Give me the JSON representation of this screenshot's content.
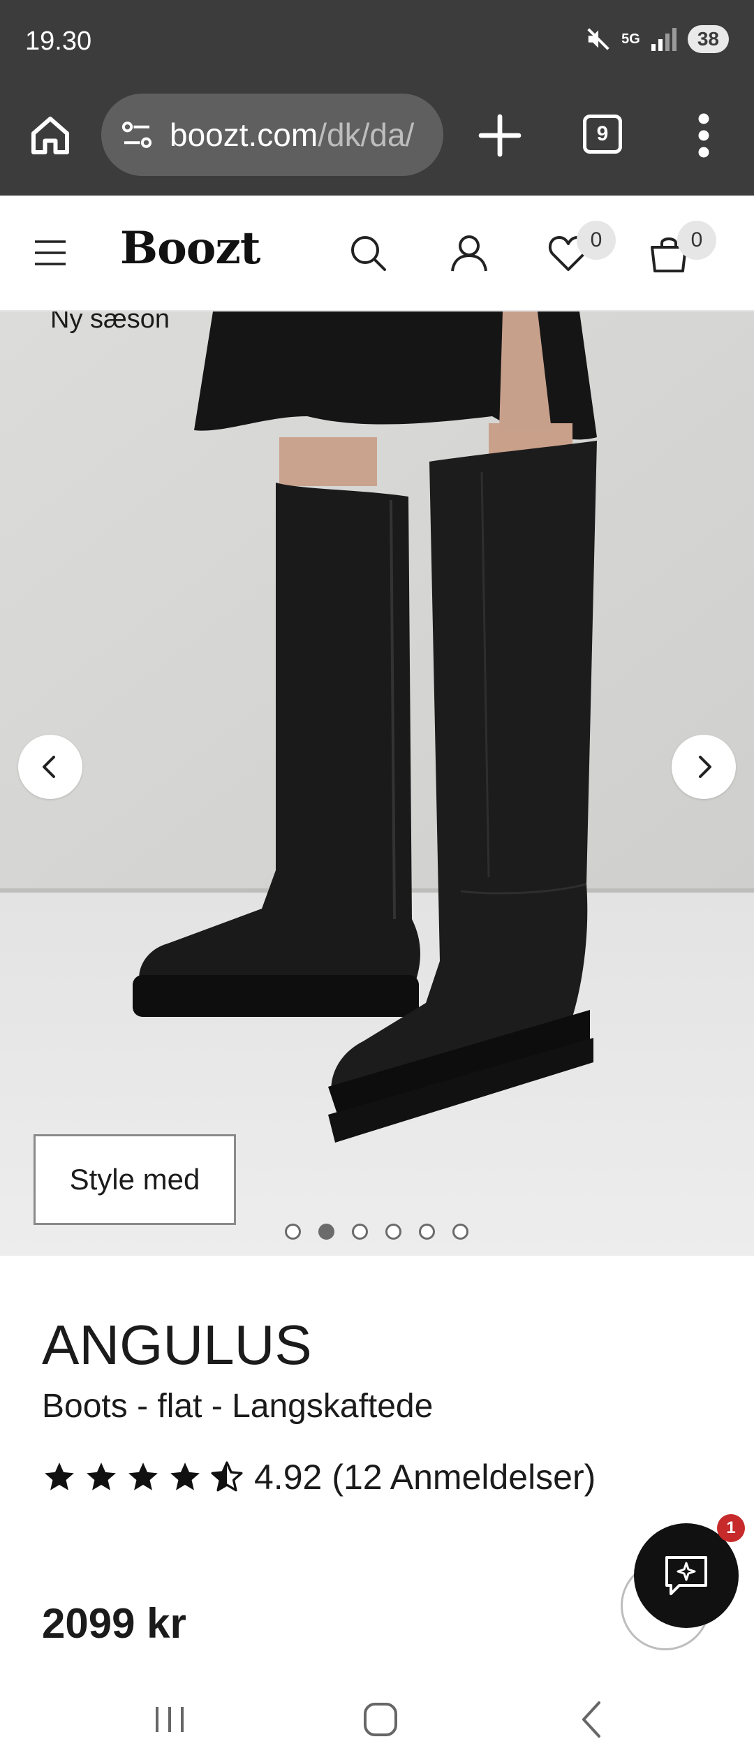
{
  "status_bar": {
    "time": "19.30",
    "network": "5G",
    "battery": "38",
    "icons": [
      "mute-icon",
      "signal-icon",
      "battery-icon"
    ]
  },
  "browser": {
    "url_main": "boozt.com",
    "url_dim": "/dk/da/",
    "tab_count": "9",
    "icons": [
      "home-icon",
      "site-settings-icon",
      "plus-icon",
      "tabs-icon",
      "more-vert-icon"
    ]
  },
  "site_header": {
    "logo": "Boozt",
    "wishlist_count": "0",
    "cart_count": "0",
    "icons": [
      "hamburger-icon",
      "search-icon",
      "user-icon",
      "heart-icon",
      "cart-icon"
    ]
  },
  "hero": {
    "badge": "Ny sæson",
    "style_button": "Style med",
    "slide_count": 6,
    "active_slide": 2
  },
  "product": {
    "brand": "ANGULUS",
    "name": "Boots - flat - Langskaftede",
    "rating": "4.92",
    "reviews": "(12 Anmeldelser)",
    "stars": 4.5,
    "price": "2099 kr"
  },
  "chat": {
    "badge_count": "1"
  },
  "colors": {
    "status_bg": "#3c3c3c",
    "url_box": "#5f5f5f",
    "text": "#1b1b1b",
    "chat_badge": "#c62a2a"
  }
}
